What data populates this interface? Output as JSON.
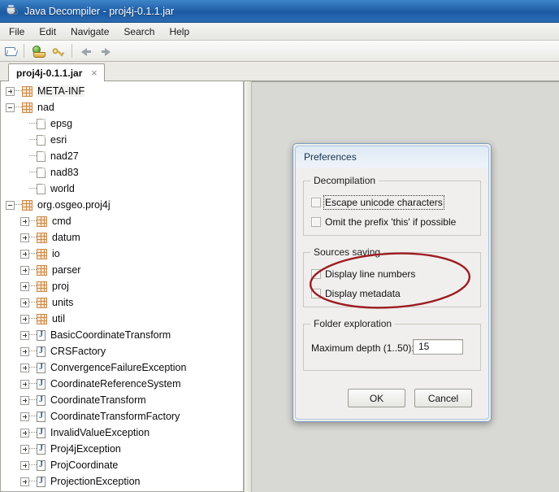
{
  "window": {
    "title": "Java Decompiler - proj4j-0.1.1.jar",
    "icon": "java-cup-icon"
  },
  "menubar": {
    "items": [
      {
        "label": "File"
      },
      {
        "label": "Edit"
      },
      {
        "label": "Navigate"
      },
      {
        "label": "Search"
      },
      {
        "label": "Help"
      }
    ]
  },
  "toolbar": {
    "buttons": [
      {
        "name": "open-file-icon"
      },
      {
        "name": "save-jar-icon"
      },
      {
        "name": "search-key-icon"
      },
      {
        "name": "navigate-back-icon"
      },
      {
        "name": "navigate-forward-icon"
      }
    ]
  },
  "tabs": [
    {
      "label": "proj4j-0.1.1.jar",
      "close": "×",
      "active": true
    }
  ],
  "tree": {
    "nodes": [
      {
        "label": "META-INF",
        "indent": 0,
        "handle": "plus",
        "icon": "package-icon",
        "selected": true
      },
      {
        "label": "nad",
        "indent": 0,
        "handle": "minus",
        "icon": "package-icon"
      },
      {
        "label": "epsg",
        "indent": 1,
        "handle": "none",
        "icon": "file-icon"
      },
      {
        "label": "esri",
        "indent": 1,
        "handle": "none",
        "icon": "file-icon"
      },
      {
        "label": "nad27",
        "indent": 1,
        "handle": "none",
        "icon": "file-icon"
      },
      {
        "label": "nad83",
        "indent": 1,
        "handle": "none",
        "icon": "file-icon"
      },
      {
        "label": "world",
        "indent": 1,
        "handle": "none",
        "icon": "file-icon"
      },
      {
        "label": "org.osgeo.proj4j",
        "indent": 0,
        "handle": "minus",
        "icon": "package-icon"
      },
      {
        "label": "cmd",
        "indent": 1,
        "handle": "plus",
        "icon": "package-icon"
      },
      {
        "label": "datum",
        "indent": 1,
        "handle": "plus",
        "icon": "package-icon"
      },
      {
        "label": "io",
        "indent": 1,
        "handle": "plus",
        "icon": "package-icon"
      },
      {
        "label": "parser",
        "indent": 1,
        "handle": "plus",
        "icon": "package-icon"
      },
      {
        "label": "proj",
        "indent": 1,
        "handle": "plus",
        "icon": "package-icon"
      },
      {
        "label": "units",
        "indent": 1,
        "handle": "plus",
        "icon": "package-icon"
      },
      {
        "label": "util",
        "indent": 1,
        "handle": "plus",
        "icon": "package-icon"
      },
      {
        "label": "BasicCoordinateTransform",
        "indent": 1,
        "handle": "plus",
        "icon": "java-class-icon"
      },
      {
        "label": "CRSFactory",
        "indent": 1,
        "handle": "plus",
        "icon": "java-class-icon"
      },
      {
        "label": "ConvergenceFailureException",
        "indent": 1,
        "handle": "plus",
        "icon": "java-class-icon"
      },
      {
        "label": "CoordinateReferenceSystem",
        "indent": 1,
        "handle": "plus",
        "icon": "java-class-icon"
      },
      {
        "label": "CoordinateTransform",
        "indent": 1,
        "handle": "plus",
        "icon": "java-class-icon"
      },
      {
        "label": "CoordinateTransformFactory",
        "indent": 1,
        "handle": "plus",
        "icon": "java-class-icon"
      },
      {
        "label": "InvalidValueException",
        "indent": 1,
        "handle": "plus",
        "icon": "java-class-icon"
      },
      {
        "label": "Proj4jException",
        "indent": 1,
        "handle": "plus",
        "icon": "java-class-icon"
      },
      {
        "label": "ProjCoordinate",
        "indent": 1,
        "handle": "plus",
        "icon": "java-class-icon"
      },
      {
        "label": "ProjectionException",
        "indent": 1,
        "handle": "plus",
        "icon": "java-class-icon"
      }
    ]
  },
  "dialog": {
    "title": "Preferences",
    "groups": {
      "decompilation": {
        "title": "Decompilation",
        "options": [
          {
            "label": "Escape unicode characters",
            "checked": false,
            "focused": true
          },
          {
            "label": "Omit the prefix 'this' if possible",
            "checked": false,
            "focused": false
          }
        ]
      },
      "sources_saving": {
        "title": "Sources saving",
        "options": [
          {
            "label": "Display line numbers",
            "checked": false,
            "focused": false
          },
          {
            "label": "Display metadata",
            "checked": false,
            "focused": false
          }
        ]
      },
      "folder_exploration": {
        "title": "Folder exploration",
        "depth_label": "Maximum depth (1..50):",
        "depth_value": "15"
      }
    },
    "buttons": {
      "ok": "OK",
      "cancel": "Cancel"
    }
  },
  "annotation": {
    "shape": "red-ellipse-highlight",
    "color": "#9e1b22"
  }
}
